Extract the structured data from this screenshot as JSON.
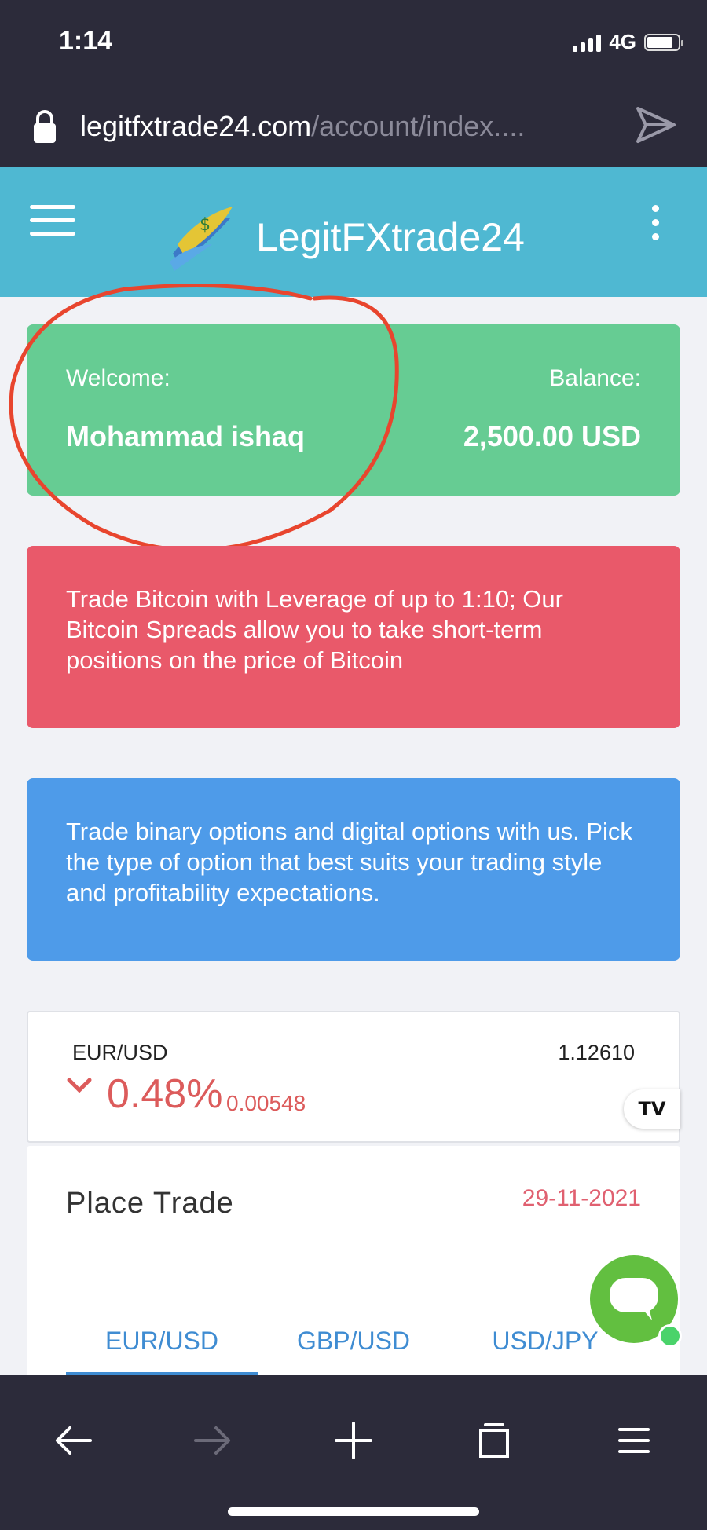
{
  "status_bar": {
    "time": "1:14",
    "network": "4G",
    "battery_level": 0.85
  },
  "url_bar": {
    "host": "legitfxtrade24.com",
    "path": "/account/index...."
  },
  "header": {
    "title": "LegitFXtrade24"
  },
  "account": {
    "welcome_label": "Welcome:",
    "user_name": "Mohammad ishaq",
    "balance_label": "Balance:",
    "balance_value": "2,500.00 USD"
  },
  "promos": [
    {
      "text": "Trade Bitcoin with Leverage of up to 1:10; Our Bitcoin Spreads allow you to take short-term positions on the price of Bitcoin",
      "color": "#e9596a"
    },
    {
      "text": "Trade binary options and digital options with us. Pick the type of option that best suits your trading style and profitability expectations.",
      "color": "#4e9be9"
    }
  ],
  "ticker": {
    "pair": "EUR/USD",
    "price": "1.12610",
    "change_percent": "0.48%",
    "change_value": "0.00548",
    "badge": "TV",
    "change_color": "#dc5b5b"
  },
  "place_trade": {
    "title": "Place Trade",
    "date": "29-11-2021",
    "tabs": [
      {
        "label": "EUR/USD",
        "active": true
      },
      {
        "label": "GBP/USD",
        "active": false
      },
      {
        "label": "USD/JPY",
        "active": false
      }
    ]
  },
  "colors": {
    "header": "#4fb8d2",
    "welcome_card": "#66cc93",
    "annotation": "#e8452e",
    "chat": "#62bf40"
  },
  "icons": [
    "lock-icon",
    "share-icon",
    "hamburger-icon",
    "logo-icon",
    "kebab-icon",
    "chevron-down-icon",
    "chat-icon",
    "back-icon",
    "forward-icon",
    "new-tab-icon",
    "tabs-icon",
    "menu-icon"
  ]
}
